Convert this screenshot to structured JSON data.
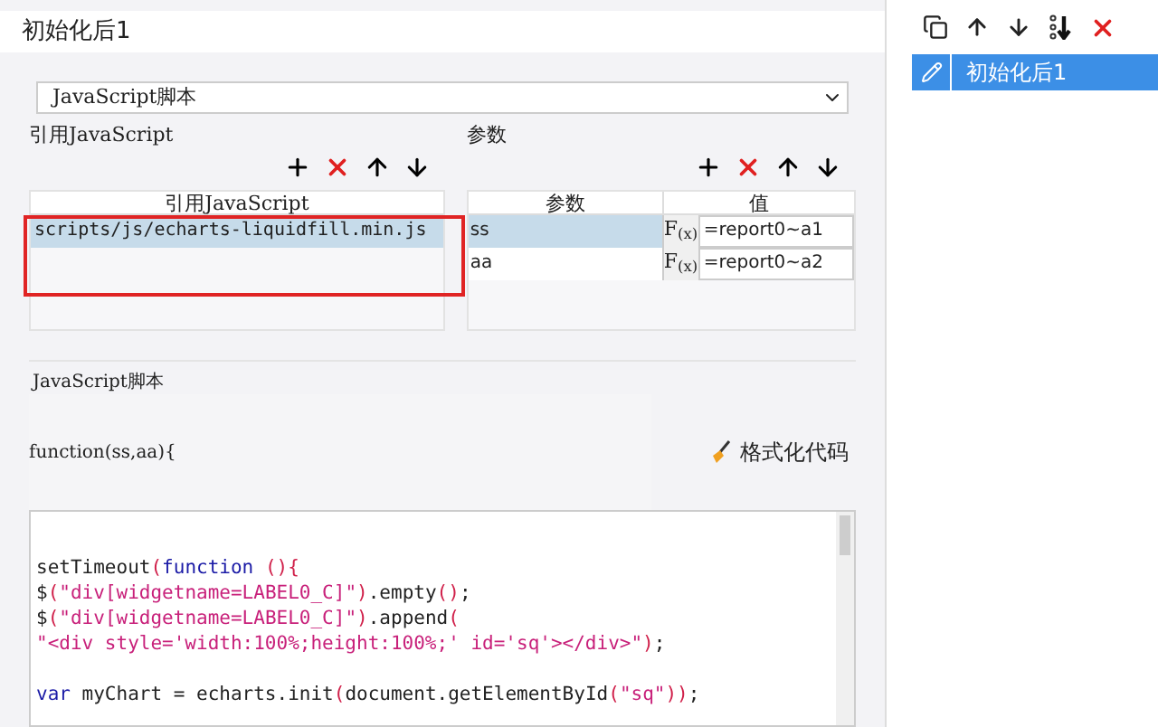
{
  "dialog": {
    "title": "初始化后1",
    "dropdown": {
      "value": "JavaScript脚本"
    },
    "references": {
      "label": "引用JavaScript",
      "column": "引用JavaScript",
      "rows": [
        {
          "value": "scripts/js/echarts-liquidfill.min.js",
          "selected": true
        }
      ]
    },
    "parameters": {
      "label": "参数",
      "columns": [
        "参数",
        "值"
      ],
      "rows": [
        {
          "name": "ss",
          "formula_label": "F$_{(x)}$",
          "value": "=report0~a1",
          "selected": true
        },
        {
          "name": "aa",
          "formula_label": "F$_{(x)}$",
          "value": "=report0~a2",
          "selected": false
        }
      ]
    },
    "script": {
      "label": "JavaScript脚本",
      "signature": "function(ss,aa){",
      "format_button": "格式化代码",
      "code_lines": [
        [
          {
            "kind": "plain",
            "text": "setTimeout"
          },
          {
            "kind": "punct",
            "text": "("
          },
          {
            "kind": "keyword",
            "text": "function"
          },
          {
            "kind": "punct",
            "text": " (){"
          }
        ],
        [
          {
            "kind": "plain",
            "text": "$"
          },
          {
            "kind": "punct",
            "text": "("
          },
          {
            "kind": "string",
            "text": "\"div[widgetname=LABEL0_C]\""
          },
          {
            "kind": "punct",
            "text": ")"
          },
          {
            "kind": "plain",
            "text": ".empty"
          },
          {
            "kind": "punct",
            "text": "()"
          },
          {
            "kind": "plain",
            "text": ";"
          }
        ],
        [
          {
            "kind": "plain",
            "text": "$"
          },
          {
            "kind": "punct",
            "text": "("
          },
          {
            "kind": "string",
            "text": "\"div[widgetname=LABEL0_C]\""
          },
          {
            "kind": "punct",
            "text": ")"
          },
          {
            "kind": "plain",
            "text": ".append"
          },
          {
            "kind": "punct",
            "text": "("
          }
        ],
        [
          {
            "kind": "string",
            "text": "\"<div style='width:100%;height:100%;' id='sq'></div>\""
          },
          {
            "kind": "punct",
            "text": ")"
          },
          {
            "kind": "plain",
            "text": ";"
          }
        ],
        [
          {
            "kind": "gap"
          },
          {
            "kind": "keyword",
            "text": "var"
          },
          {
            "kind": "plain",
            "text": " myChart = echarts.init"
          },
          {
            "kind": "punct",
            "text": "("
          },
          {
            "kind": "plain",
            "text": "document.getElementById"
          },
          {
            "kind": "punct",
            "text": "("
          },
          {
            "kind": "string",
            "text": "\"sq\""
          },
          {
            "kind": "punct",
            "text": "))"
          },
          {
            "kind": "plain",
            "text": ";"
          }
        ]
      ]
    }
  },
  "side_panel": {
    "items": [
      {
        "label": "初始化后1",
        "selected": true
      }
    ]
  }
}
